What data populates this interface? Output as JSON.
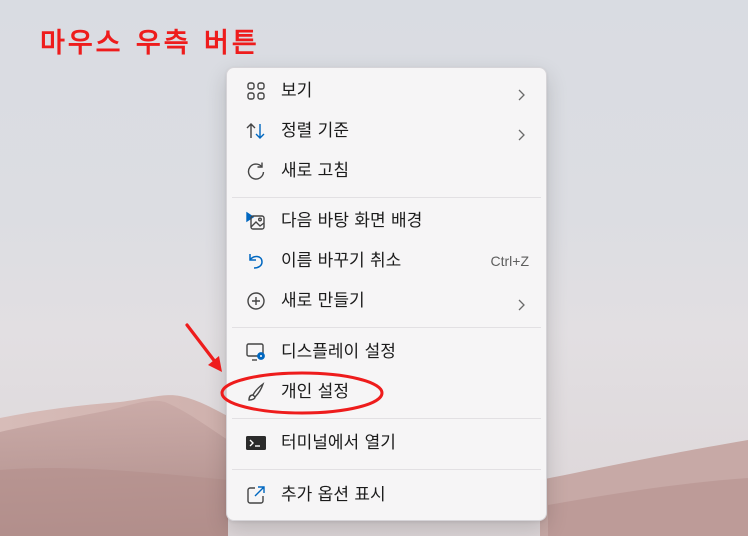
{
  "annotation": {
    "title": "마우스 우측 버튼",
    "color": "#ee1c1c"
  },
  "menu": {
    "items": [
      {
        "label": "보기",
        "icon": "grid-icon",
        "submenu": true
      },
      {
        "label": "정렬 기준",
        "icon": "sort-icon",
        "submenu": true
      },
      {
        "label": "새로 고침",
        "icon": "refresh-icon",
        "submenu": false
      },
      {
        "label": "다음 바탕 화면 배경",
        "icon": "next-background-icon",
        "submenu": false
      },
      {
        "label": "이름 바꾸기 취소",
        "icon": "undo-icon",
        "shortcut": "Ctrl+Z",
        "submenu": false
      },
      {
        "label": "새로 만들기",
        "icon": "new-plus-icon",
        "submenu": true
      },
      {
        "label": "디스플레이 설정",
        "icon": "display-settings-icon",
        "submenu": false
      },
      {
        "label": "개인 설정",
        "icon": "paintbrush-icon",
        "submenu": false,
        "highlighted": true
      },
      {
        "label": "터미널에서 열기",
        "icon": "terminal-icon",
        "submenu": false
      },
      {
        "label": "추가 옵션 표시",
        "icon": "more-options-icon",
        "submenu": false
      }
    ]
  },
  "colors": {
    "accent": "#0067c0",
    "annotation": "#ee1c1c",
    "menu_bg": "#f7f6f7"
  }
}
